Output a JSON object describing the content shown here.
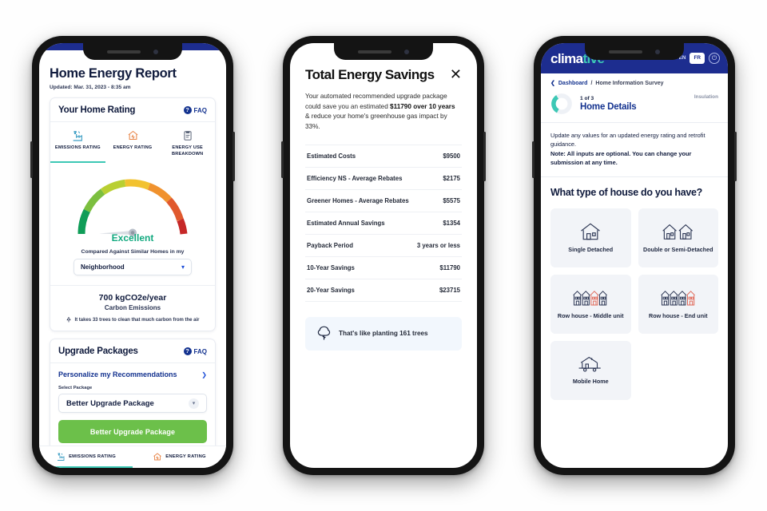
{
  "phone1": {
    "page_title": "Home Energy Report",
    "updated": "Updated: Mar. 31, 2023 - 8:35 am",
    "rating_card": {
      "title": "Your Home Rating",
      "faq_label": "FAQ",
      "faq_icon": "question-circle-icon",
      "tabs": [
        {
          "label": "EMISSIONS RATING",
          "icon": "emissions-factory-icon",
          "active": true
        },
        {
          "label": "ENERGY RATING",
          "icon": "house-energy-icon",
          "active": false
        },
        {
          "label": "ENERGY USE BREAKDOWN",
          "icon": "clipboard-icon",
          "active": false
        }
      ],
      "gauge": {
        "rating_word": "Excellent",
        "rating_color": "#12a97f",
        "needle_angle_deg": -52,
        "segments": [
          "#0f9d58",
          "#7cbf3f",
          "#c9d32e",
          "#f2c230",
          "#f0922e",
          "#e0592e",
          "#c62828"
        ]
      },
      "compare_label": "Compared Against Similar Homes in my",
      "compare_value": "Neighborhood",
      "emissions_value": "700 kgCO2e/year",
      "emissions_label": "Carbon Emissions",
      "emissions_note": "It takes 33 trees to clean that much carbon from the air",
      "tree_icon": "tree-icon"
    },
    "upgrade_card": {
      "title": "Upgrade Packages",
      "faq_label": "FAQ",
      "personalize_link": "Personalize my Recommendations",
      "chevron_icon": "chevron-right-icon",
      "select_label": "Select Package",
      "select_value": "Better Upgrade Package",
      "cta_label": "Better Upgrade Package",
      "cta_color": "#6cc04a"
    },
    "bottom_nav": [
      {
        "label": "EMISSIONS RATING",
        "icon": "emissions-factory-icon",
        "active": true
      },
      {
        "label": "ENERGY RATING",
        "icon": "house-energy-icon",
        "active": false
      }
    ]
  },
  "phone2": {
    "title": "Total Energy Savings",
    "close_icon": "close-icon",
    "intro_pre": "Your automated recommended upgrade package could save you an estimated ",
    "intro_bold": "$11790 over 10 years",
    "intro_post": " & reduce your home's greenhouse gas impact by 33%.",
    "rows": [
      {
        "label": "Estimated Costs",
        "value": "$9500"
      },
      {
        "label": "Efficiency NS - Average Rebates",
        "value": "$2175"
      },
      {
        "label": "Greener Homes - Average Rebates",
        "value": "$5575"
      },
      {
        "label": "Estimated Annual Savings",
        "value": "$1354"
      },
      {
        "label": "Payback Period",
        "value": "3 years or less"
      },
      {
        "label": "10-Year Savings",
        "value": "$11790"
      },
      {
        "label": "20-Year Savings",
        "value": "$23715"
      }
    ],
    "callout": {
      "icon": "tree-icon",
      "text": "That's like planting 161 trees",
      "bg": "#f2f7fd"
    }
  },
  "phone3": {
    "logo_part1": "clima",
    "logo_part2": "tive",
    "brand_navy": "#1d2d8f",
    "brand_teal": "#3dc8b5",
    "lang_en": "EN",
    "lang_fr": "FR",
    "power_icon": "power-icon",
    "breadcrumb_back": "Dashboard",
    "breadcrumb_sep": "/",
    "breadcrumb_current": "Home Information Survey",
    "back_icon": "chevron-left-icon",
    "step_count": "1 of 3",
    "step_title": "Home Details",
    "section_tag": "Insulation",
    "instruction_line1": "Update any values for an updated energy rating and retrofit guidance.",
    "instruction_note": "Note: All inputs are optional. You can change your submission at any time.",
    "question": "What type of house do you have?",
    "options": [
      {
        "label": "Single Detached",
        "icon": "single-house-icon"
      },
      {
        "label": "Double or Semi-Detached",
        "icon": "semi-detached-house-icon"
      },
      {
        "label": "Row house - Middle unit",
        "icon": "row-house-middle-icon"
      },
      {
        "label": "Row house - End unit",
        "icon": "row-house-end-icon"
      },
      {
        "label": "Mobile Home",
        "icon": "mobile-home-icon"
      }
    ]
  }
}
